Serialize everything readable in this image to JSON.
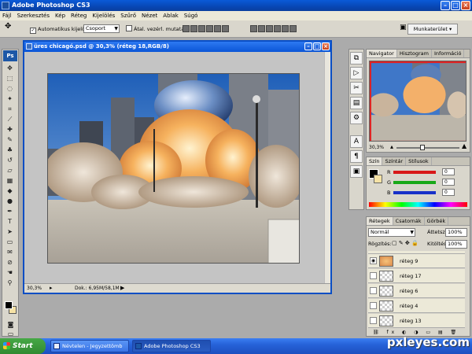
{
  "app": {
    "title": "Adobe Photoshop CS3"
  },
  "menubar": {
    "items": [
      "Fájl",
      "Szerkesztés",
      "Kép",
      "Réteg",
      "Kijelölés",
      "Szűrő",
      "Nézet",
      "Ablak",
      "Súgó"
    ]
  },
  "options": {
    "auto_select_label": "Automatikus kijelölés:",
    "auto_select_value": "Csoport",
    "transform_label": "Átal. vezérl. mutatása",
    "workspace_label": "Munkaterület"
  },
  "document": {
    "title": "üres chicagó.psd @ 30,3% (réteg 18,RGB/8)",
    "zoom": "30,3%",
    "doc_info": "Dok.: 6,95M/58,1M"
  },
  "navigator": {
    "tabs": [
      "Navigator",
      "Hisztogram",
      "Információ"
    ],
    "zoom": "30,3%"
  },
  "color": {
    "tabs": [
      "Szín",
      "Színtár",
      "Stílusok"
    ],
    "channels": [
      {
        "label": "R",
        "value": "0",
        "color": "#d81818"
      },
      {
        "label": "G",
        "value": "0",
        "color": "#18a818"
      },
      {
        "label": "B",
        "value": "0",
        "color": "#1830c8"
      }
    ]
  },
  "layers": {
    "tabs": [
      "Rétegek",
      "Csatornák",
      "Görbék"
    ],
    "blend_mode": "Normál",
    "opacity_label": "Áttetsz.:",
    "opacity_value": "100%",
    "lock_label": "Rögzítés:",
    "fill_label": "Kitöltés:",
    "fill_value": "100%",
    "items": [
      {
        "name": "réteg 9",
        "visible": true
      },
      {
        "name": "réteg 17",
        "visible": false
      },
      {
        "name": "réteg 6",
        "visible": false
      },
      {
        "name": "réteg 4",
        "visible": false
      },
      {
        "name": "réteg 13",
        "visible": false
      }
    ]
  },
  "taskbar": {
    "start": "Start",
    "tasks": [
      "Névtelen - Jegyzettömb",
      "Adobe Photoshop CS3"
    ]
  },
  "watermark": "pxleyes.com"
}
